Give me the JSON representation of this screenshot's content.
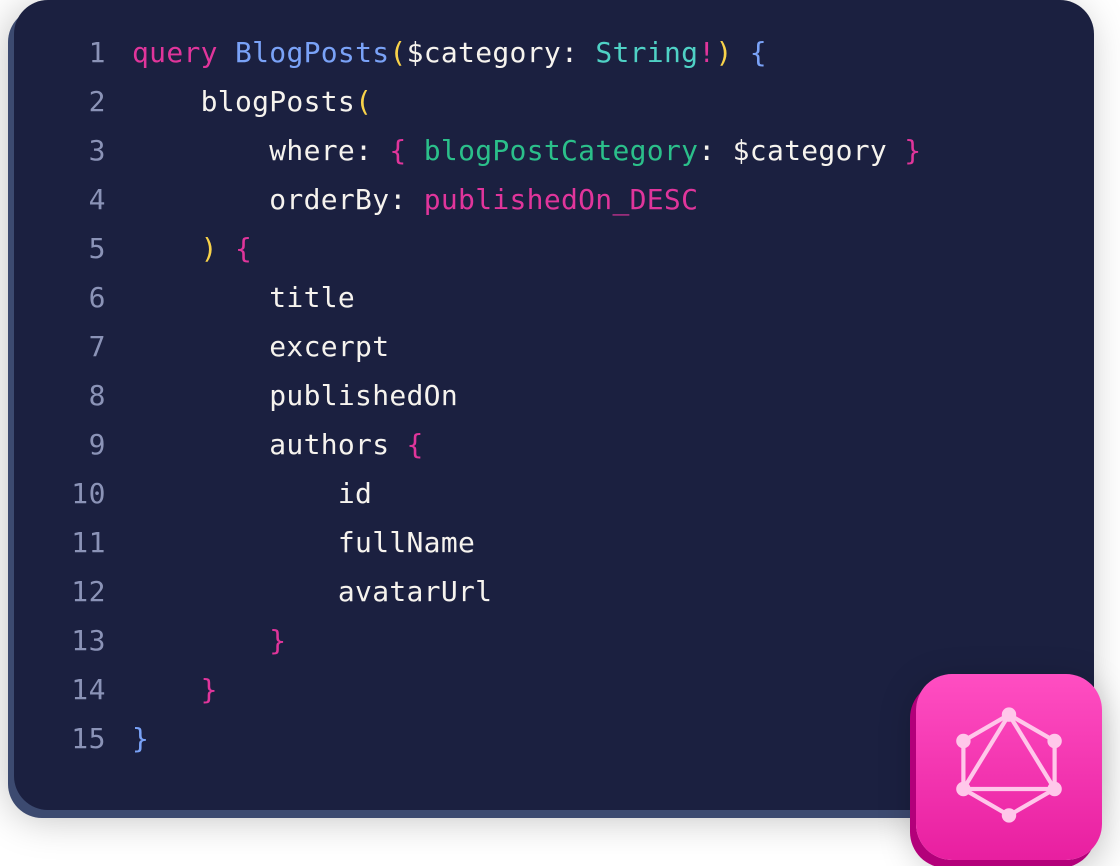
{
  "code": {
    "language": "graphql",
    "line_count": 15,
    "lines": {
      "l1": {
        "kw": "query",
        "name": "BlogPosts",
        "paren_o": "(",
        "var": "$category",
        "colon": ":",
        "type": "String",
        "bang": "!",
        "paren_c": ")",
        "curly_o": "{"
      },
      "l2": {
        "indent": "    ",
        "field": "blogPosts",
        "paren_o": "("
      },
      "l3": {
        "indent": "        ",
        "arg": "where",
        "colon": ":",
        "curly_o": "{",
        "prop": "blogPostCategory",
        "colon2": ":",
        "varref": "$category",
        "curly_c": "}"
      },
      "l4": {
        "indent": "        ",
        "arg": "orderBy",
        "colon": ":",
        "enum": "publishedOn_DESC"
      },
      "l5": {
        "indent": "    ",
        "paren_c": ")",
        "curly_o": "{"
      },
      "l6": {
        "indent": "        ",
        "field": "title"
      },
      "l7": {
        "indent": "        ",
        "field": "excerpt"
      },
      "l8": {
        "indent": "        ",
        "field": "publishedOn"
      },
      "l9": {
        "indent": "        ",
        "field": "authors",
        "curly_o": "{"
      },
      "l10": {
        "indent": "            ",
        "field": "id"
      },
      "l11": {
        "indent": "            ",
        "field": "fullName"
      },
      "l12": {
        "indent": "            ",
        "field": "avatarUrl"
      },
      "l13": {
        "indent": "        ",
        "curly_c": "}"
      },
      "l14": {
        "indent": "    ",
        "curly_c": "}"
      },
      "l15": {
        "curly_c": "}"
      }
    },
    "gutter": {
      "n1": "1",
      "n2": "2",
      "n3": "3",
      "n4": "4",
      "n5": "5",
      "n6": "6",
      "n7": "7",
      "n8": "8",
      "n9": "9",
      "n10": "10",
      "n11": "11",
      "n12": "12",
      "n13": "13",
      "n14": "14",
      "n15": "15"
    }
  },
  "badge": {
    "icon": "graphql-icon",
    "color": "#e81fa0"
  }
}
